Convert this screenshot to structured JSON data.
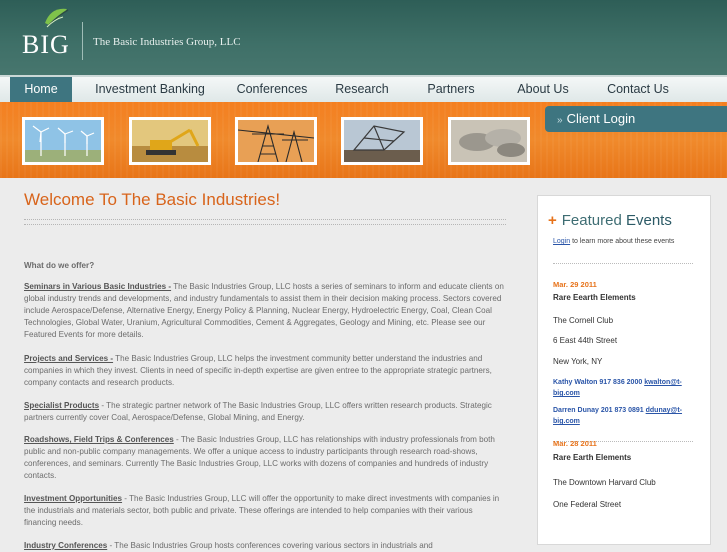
{
  "header": {
    "logo_text": "BIG",
    "company_name": "The Basic Industries Group, LLC"
  },
  "nav": {
    "items": [
      {
        "label": "Home"
      },
      {
        "label": "Investment Banking"
      },
      {
        "label": "Conferences"
      },
      {
        "label": "Research"
      },
      {
        "label": "Partners"
      },
      {
        "label": "About Us"
      },
      {
        "label": "Contact Us"
      }
    ]
  },
  "banner": {
    "client_login": "Client Login",
    "client_login_arrow": "»",
    "thumbnails": [
      "wind-turbines",
      "excavator",
      "power-towers",
      "mining-machine",
      "pipes"
    ]
  },
  "main": {
    "title": "Welcome To The Basic Industries!",
    "question": "What do we offer?",
    "sections": [
      {
        "lead": "Seminars in Various Basic Industries -",
        "text": " The Basic Industries Group, LLC hosts a series of seminars to inform and educate clients on global industry trends and developments, and industry fundamentals to assist them in their decision making process. Sectors covered include Aerospace/Defense, Alternative Energy, Energy Policy & Planning, Nuclear Energy, Hydroelectric Energy, Coal, Clean Coal Technologies, Global Water, Uranium, Agricultural Commodities, Cement & Aggregates, Geology and Mining, etc. Please see our Featured Events for more details."
      },
      {
        "lead": "Projects and Services -",
        "text": " The Basic Industries Group, LLC helps the investment community better understand the industries and companies in which they invest. Clients in need of specific in-depth expertise are given entree to the appropriate strategic partners, company contacts and research products."
      },
      {
        "lead": "Specialist Products",
        "text": " - The strategic partner network of The Basic Industries Group, LLC offers written research products. Strategic partners currently cover Coal, Aerospace/Defense, Global Mining, and Energy."
      },
      {
        "lead": "Roadshows, Field Trips & Conferences",
        "text": " - The Basic Industries Group, LLC has relationships with industry professionals from both public and non-public company managements. We offer a unique access to industry participants through research road-shows, conferences, and seminars. Currently The Basic Industries Group, LLC works with dozens of companies and hundreds of industry contacts."
      },
      {
        "lead": "Investment Opportunities",
        "text": " - The Basic Industries Group, LLC will offer the opportunity to make direct investments with companies in the industrials and materials sector, both public and private. These offerings are intended to help companies with their various financing needs."
      },
      {
        "lead": "Industry Conferences",
        "text": " - The Basic Industries Group hosts conferences covering various sectors in industrials and"
      }
    ]
  },
  "sidebar": {
    "title_prefix": "Featured",
    "title_suffix": "Events",
    "login_link": "Login",
    "login_rest": " to learn more about these events",
    "events": [
      {
        "date": "Mar. 29 2011",
        "name": "Rare Eearth Elements",
        "venue": "The Cornell Club",
        "address": "6 East 44th Street",
        "city": "New York, NY",
        "contact1": "Kathy Walton 917 836 2000",
        "contact1_email": "kwalton@t-big.com",
        "contact2": "Darren Dunay 201 873 0891",
        "contact2_email": "ddunay@t-big.com"
      },
      {
        "date": "Mar. 28 2011",
        "name": "Rare Earth Elements",
        "venue": "The Downtown Harvard Club",
        "address": "One Federal Street"
      }
    ]
  },
  "colors": {
    "header_teal": "#3f7068",
    "nav_active": "#3e7580",
    "banner_orange": "#f47f20",
    "accent_orange": "#d8641b",
    "link_blue": "#2a55a8"
  }
}
